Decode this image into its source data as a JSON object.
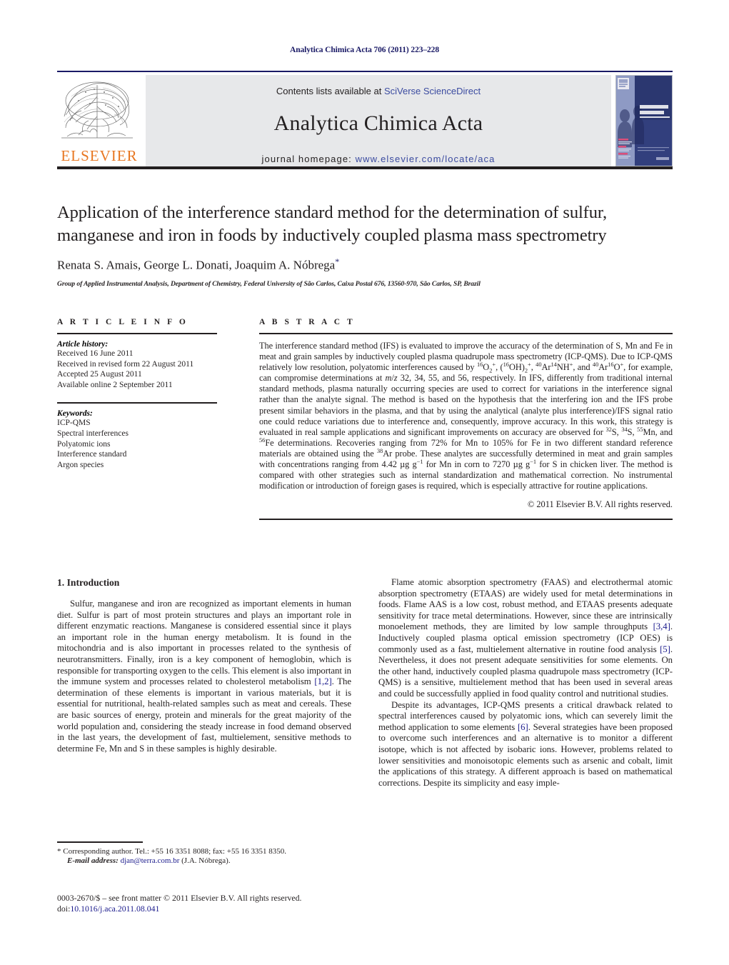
{
  "running_head": "Analytica Chimica Acta 706 (2011) 223–228",
  "masthead": {
    "contents_prefix": "Contents lists available at ",
    "sciencedirect": "SciVerse ScienceDirect",
    "journal_title": "Analytica Chimica Acta",
    "homepage_prefix": "journal homepage: ",
    "homepage_url": "www.elsevier.com/locate/aca",
    "publisher": "ELSEVIER",
    "cover_title_line1": "ANALYTICA",
    "cover_title_line2": "CHIMICA ACTA",
    "colors": {
      "rule_navy": "#1a1a66",
      "band_grey": "#e7e8ea",
      "link_blue": "#3b4ba0",
      "elsevier_orange": "#E87722"
    }
  },
  "title_block": {
    "title": "Application of the interference standard method for the determination of sulfur, manganese and iron in foods by inductively coupled plasma mass spectrometry",
    "authors": "Renata S. Amais, George L. Donati, Joaquim A. Nóbrega",
    "corresponding_marker": "*",
    "affiliation": "Group of Applied Instrumental Analysis, Department of Chemistry, Federal University of São Carlos, Caixa Postal 676, 13560-970, São Carlos, SP, Brazil"
  },
  "article_info": {
    "heading": "A R T I C L E   I N F O",
    "history_label": "Article history:",
    "history": [
      "Received 16 June 2011",
      "Received in revised form 22 August 2011",
      "Accepted 25 August 2011",
      "Available online 2 September 2011"
    ],
    "keywords_label": "Keywords:",
    "keywords": [
      "ICP-QMS",
      "Spectral interferences",
      "Polyatomic ions",
      "Interference standard",
      "Argon species"
    ]
  },
  "abstract": {
    "heading": "A B S T R A C T",
    "copyright": "© 2011 Elsevier B.V. All rights reserved."
  },
  "introduction": {
    "heading": "1.  Introduction",
    "left_paragraph_1": "Sulfur, manganese and iron are recognized as important elements in human diet. Sulfur is part of most protein structures and plays an important role in different enzymatic reactions. Manganese is considered essential since it plays an important role in the human energy metabolism. It is found in the mitochondria and is also important in processes related to the synthesis of neurotransmitters. Finally, iron is a key component of hemoglobin, which is responsible for transporting oxygen to the cells. This element is also important in the immune system and processes related to cholesterol metabolism",
    "left_ref_1": "[1,2]",
    "left_paragraph_1_cont": ". The determination of these elements is important in various materials, but it is essential for nutritional, health-related samples such as meat and cereals. These are basic sources of energy, protein and minerals for the great majority of the world population and, considering the steady increase in food demand observed in the last years, the development of fast, multielement, sensitive methods to determine Fe, Mn and S in these samples is highly desirable.",
    "right_p1_a": "Flame atomic absorption spectrometry (FAAS) and electrothermal atomic absorption spectrometry (ETAAS) are widely used for metal determinations in foods. Flame AAS is a low cost, robust method, and ETAAS presents adequate sensitivity for trace metal determinations. However, since these are intrinsically monoelement methods, they are limited by low sample throughputs ",
    "right_ref_1": "[3,4]",
    "right_p1_b": ". Inductively coupled plasma optical emission spectrometry (ICP OES) is commonly used as a fast, multielement alternative in routine food analysis ",
    "right_ref_2": "[5]",
    "right_p1_c": ". Nevertheless, it does not present adequate sensitivities for some elements. On the other hand, inductively coupled plasma quadrupole mass spectrometry (ICP-QMS) is a sensitive, multielement method that has been used in several areas and could be successfully applied in food quality control and nutritional studies.",
    "right_p2_a": "Despite its advantages, ICP-QMS presents a critical drawback related to spectral interferences caused by polyatomic ions, which can severely limit the method application to some elements ",
    "right_ref_3": "[6]",
    "right_p2_b": ". Several strategies have been proposed to overcome such interferences and an alternative is to monitor a different isotope, which is not affected by isobaric ions. However, problems related to lower sensitivities and monoisotopic elements such as arsenic and cobalt, limit the applications of this strategy. A different approach is based on mathematical corrections. Despite its simplicity and easy imple-"
  },
  "footnotes": {
    "corresponding": "* Corresponding author. Tel.: +55 16 3351 8088; fax: +55 16 3351 8350.",
    "email_label": "E-mail address:",
    "email": "djan@terra.com.br",
    "email_suffix": "(J.A. Nóbrega).",
    "issn_line": "0003-2670/$ – see front matter © 2011 Elsevier B.V. All rights reserved.",
    "doi_label": "doi:",
    "doi_value": "10.1016/j.aca.2011.08.041"
  }
}
